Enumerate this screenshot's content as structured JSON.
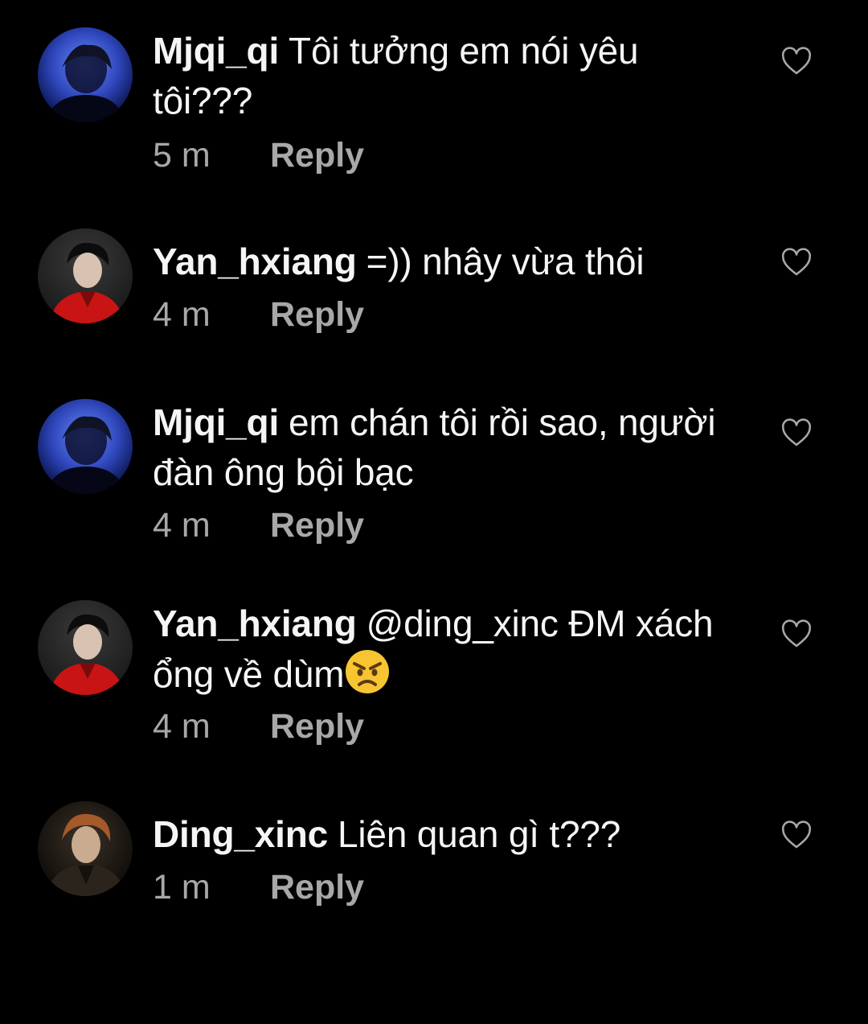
{
  "comments": [
    {
      "username": "Mjqi_qi",
      "text": "Tôi tưởng em nói yêu tôi???",
      "time": "5 m",
      "reply_label": "Reply",
      "avatar": "avatar-blue-portrait",
      "like_icon": "heart-outline-icon"
    },
    {
      "username": "Yan_hxiang",
      "text": "=)) nhây vừa thôi",
      "time": "4 m",
      "reply_label": "Reply",
      "avatar": "avatar-red-jacket-portrait",
      "like_icon": "heart-outline-icon"
    },
    {
      "username": "Mjqi_qi",
      "text": "em chán tôi rồi sao, người đàn ông bội bạc",
      "time": "4 m",
      "reply_label": "Reply",
      "avatar": "avatar-blue-portrait",
      "like_icon": "heart-outline-icon"
    },
    {
      "username": "Yan_hxiang",
      "text": "@ding_xinc ĐM xách ổng về dùm",
      "emoji": "angry-face-emoji",
      "time": "4 m",
      "reply_label": "Reply",
      "avatar": "avatar-red-jacket-portrait",
      "like_icon": "heart-outline-icon"
    },
    {
      "username": "Ding_xinc",
      "text": "Liên quan gì t???",
      "time": "1 m",
      "reply_label": "Reply",
      "avatar": "avatar-dark-portrait",
      "like_icon": "heart-outline-icon"
    }
  ],
  "colors": {
    "background": "#000000",
    "text": "#f5f5f5",
    "secondary": "#a8a8a8"
  }
}
